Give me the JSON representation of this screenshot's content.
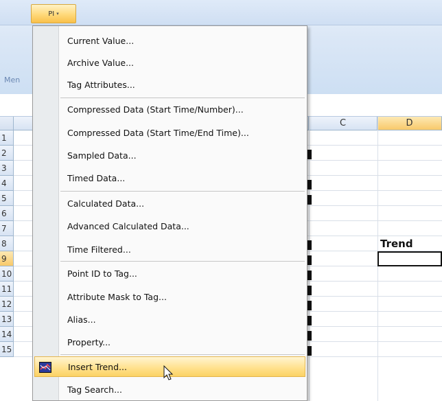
{
  "ribbon": {
    "pi_tab_label": "PI",
    "group_label": "Men"
  },
  "grid": {
    "column_headers": [
      "C",
      "D"
    ],
    "row_numbers": [
      "1",
      "2",
      "3",
      "4",
      "5",
      "6",
      "7",
      "8",
      "9",
      "10",
      "11",
      "12",
      "13",
      "14",
      "15"
    ],
    "selected_column": "D",
    "selected_row": "9",
    "cell_D8": "Trend"
  },
  "menu": {
    "items": [
      {
        "label": "Current Value..."
      },
      {
        "label": "Archive Value..."
      },
      {
        "label": "Tag Attributes..."
      },
      {
        "label": "Compressed Data (Start Time/Number)..."
      },
      {
        "label": "Compressed Data (Start Time/End Time)..."
      },
      {
        "label": "Sampled Data..."
      },
      {
        "label": "Timed Data..."
      },
      {
        "label": "Calculated Data..."
      },
      {
        "label": "Advanced Calculated Data..."
      },
      {
        "label": "Time Filtered..."
      },
      {
        "label": "Point ID to Tag..."
      },
      {
        "label": "Attribute Mask to Tag..."
      },
      {
        "label": "Alias..."
      },
      {
        "label": "Property..."
      },
      {
        "label": "Insert Trend...",
        "hover": true,
        "icon": "trend-chart-icon"
      },
      {
        "label": "Tag Search..."
      }
    ]
  }
}
